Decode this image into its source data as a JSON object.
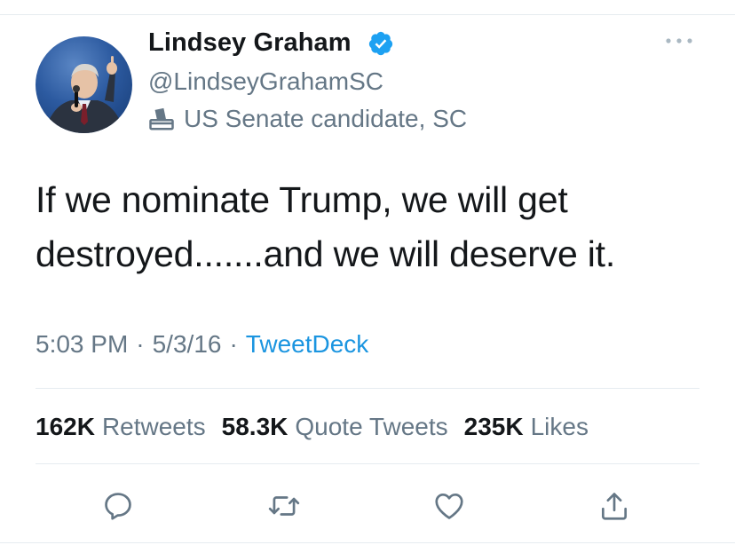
{
  "author": {
    "name": "Lindsey Graham",
    "handle": "@LindseyGrahamSC",
    "label": "US Senate candidate, SC",
    "verified": true
  },
  "tweet": {
    "text_line1": "If we nominate Trump, we will get",
    "text_line2": "destroyed.......and we will deserve it.",
    "time": "5:03 PM",
    "date": "5/3/16",
    "separator": "·",
    "source": "TweetDeck"
  },
  "stats": {
    "retweets_count": "162K",
    "retweets_label": "Retweets",
    "quotes_count": "58.3K",
    "quotes_label": "Quote Tweets",
    "likes_count": "235K",
    "likes_label": "Likes"
  },
  "icons": {
    "verified": "verified-badge-icon",
    "label": "ballot-box-icon",
    "more": "more-dots-icon",
    "reply": "reply-icon",
    "retweet": "retweet-icon",
    "like": "heart-icon",
    "share": "share-icon"
  },
  "colors": {
    "primary_text": "#14171a",
    "secondary_text": "#657786",
    "link": "#1b95e0",
    "verified": "#1da1f2",
    "divider": "#e6ecf0"
  }
}
